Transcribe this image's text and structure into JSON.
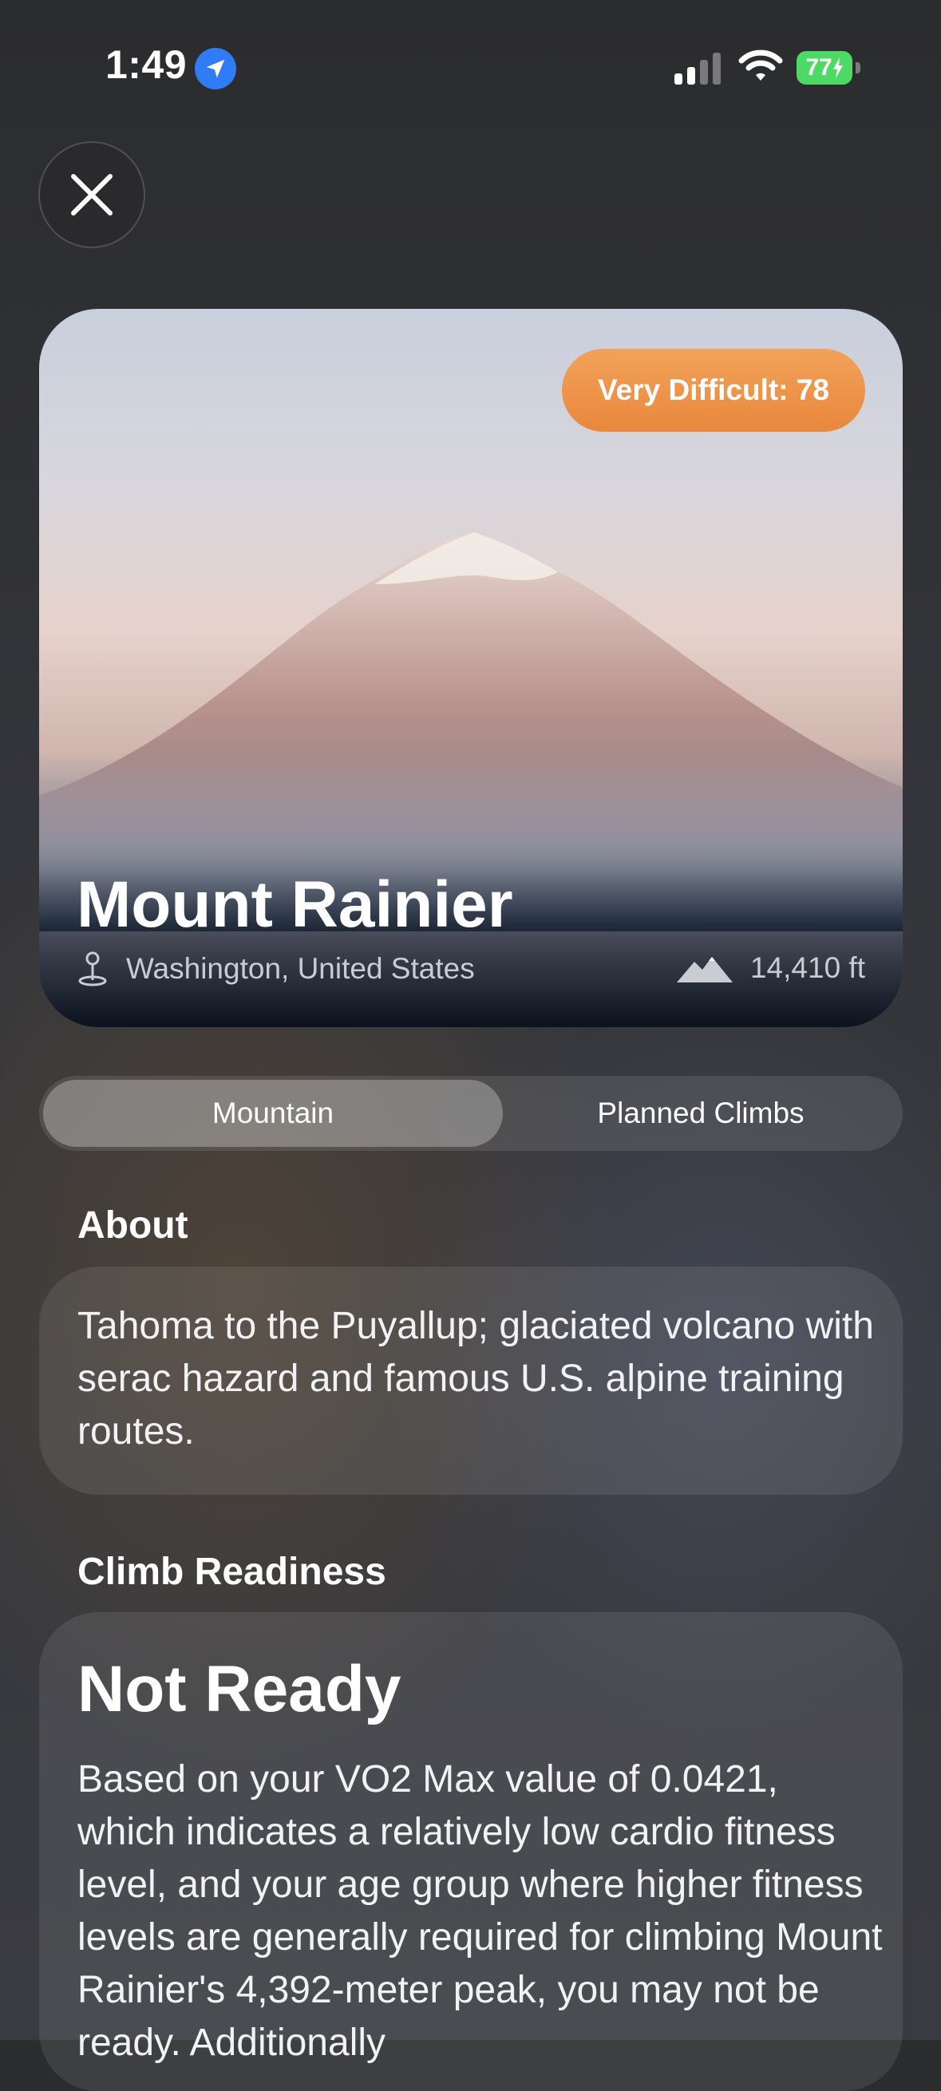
{
  "status_bar": {
    "time": "1:49",
    "battery": "77",
    "icons": [
      "location-arrow-icon",
      "cellular-signal-icon",
      "wifi-icon",
      "battery-charging-icon"
    ]
  },
  "close_button": {
    "icon": "close-icon"
  },
  "hero": {
    "difficulty_badge": "Very Difficult: 78",
    "title": "Mount Rainier",
    "location": "Washington, United States",
    "elevation": "14,410 ft",
    "badge_color": "#ee9447"
  },
  "tabs": [
    {
      "label": "Mountain",
      "selected": true
    },
    {
      "label": "Planned Climbs",
      "selected": false
    }
  ],
  "about": {
    "heading": "About",
    "text": "Tahoma to the Puyallup; glaciated volcano with serac hazard and famous U.S. alpine training routes."
  },
  "readiness": {
    "heading": "Climb Readiness",
    "status": "Not Ready",
    "text": "Based on your VO2 Max value of 0.0421, which indicates a relatively low cardio fitness level, and your age group where higher fitness levels are generally required for climbing Mount Rainier's 4,392-meter peak, you may not be ready. Additionally"
  }
}
